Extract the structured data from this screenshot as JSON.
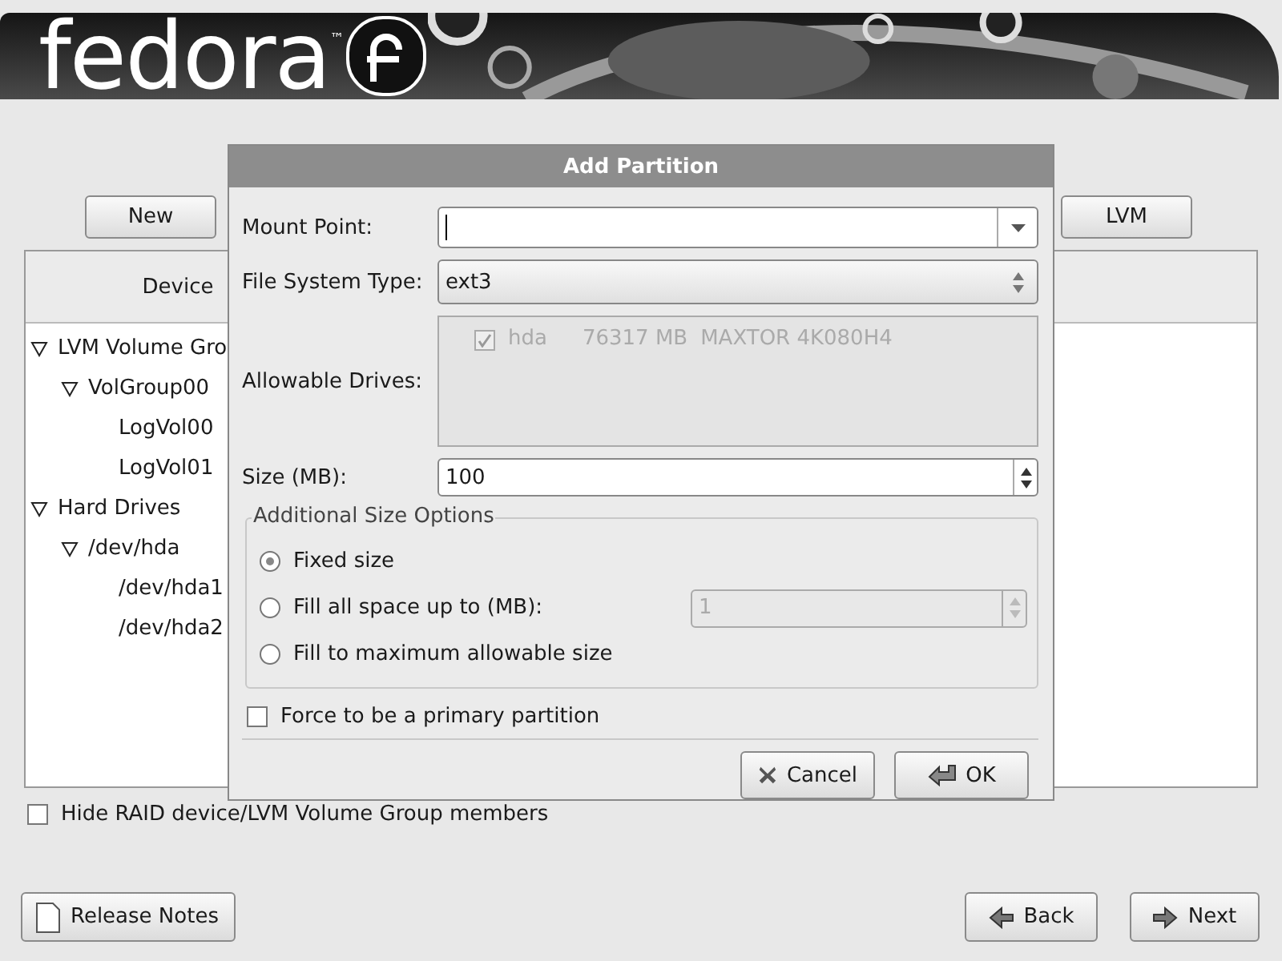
{
  "banner": {
    "logo_text": "fedora",
    "trademark": "™"
  },
  "toolbar": {
    "buttons": [
      {
        "label": "New"
      },
      {
        "label": "LVM"
      }
    ]
  },
  "table": {
    "columns": [
      "Device"
    ],
    "tree": [
      {
        "label": "LVM Volume Gro",
        "expanded": true,
        "children": [
          {
            "label": "VolGroup00",
            "expanded": true,
            "children": [
              {
                "label": "LogVol00"
              },
              {
                "label": "LogVol01"
              }
            ]
          }
        ]
      },
      {
        "label": "Hard Drives",
        "expanded": true,
        "children": [
          {
            "label": "/dev/hda",
            "expanded": true,
            "children": [
              {
                "label": "/dev/hda1"
              },
              {
                "label": "/dev/hda2"
              }
            ]
          }
        ]
      }
    ]
  },
  "hide_raid": {
    "label": "Hide RAID device/LVM Volume Group members",
    "checked": false
  },
  "dialog": {
    "title": "Add Partition",
    "mount_point": {
      "label": "Mount Point:"
    },
    "fs_type": {
      "label": "File System Type:",
      "value": "ext3"
    },
    "drives": {
      "label": "Allowable Drives:",
      "items": [
        {
          "name": "hda",
          "size": "76317 MB",
          "model": "MAXTOR 4K080H4",
          "checked": true,
          "disabled": true
        }
      ]
    },
    "size": {
      "label": "Size (MB):",
      "value": "100"
    },
    "size_options": {
      "title": "Additional Size Options",
      "options": [
        {
          "label": "Fixed size",
          "selected": true
        },
        {
          "label": "Fill all space up to (MB):",
          "selected": false,
          "spin_value": "1",
          "spin_disabled": true
        },
        {
          "label": "Fill to maximum allowable size",
          "selected": false
        }
      ]
    },
    "primary": {
      "label": "Force to be a primary partition",
      "checked": false
    },
    "buttons": [
      {
        "kind": "cancel",
        "label": "Cancel"
      },
      {
        "kind": "ok",
        "label": "OK"
      }
    ]
  },
  "nav": {
    "release_notes": "Release Notes",
    "back": "Back",
    "next": "Next"
  }
}
